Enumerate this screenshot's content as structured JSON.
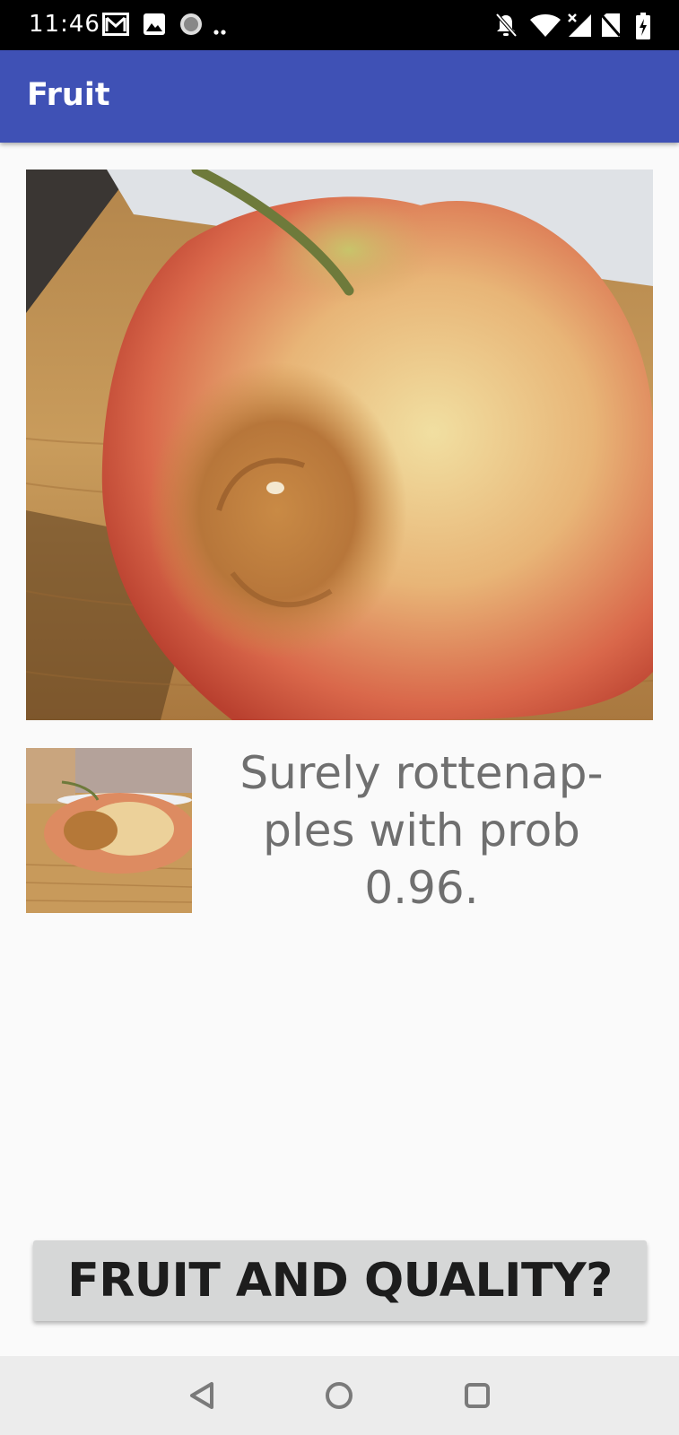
{
  "status_bar": {
    "time": "11:46",
    "left_icons": [
      "gmail-icon",
      "gallery-icon",
      "circle-notification-icon",
      "more-notifications-icon"
    ],
    "right_icons": [
      "mute-icon",
      "wifi-icon",
      "no-signal-icon",
      "no-sim-icon",
      "battery-charging-icon"
    ]
  },
  "app_bar": {
    "title": "Fruit"
  },
  "main_image": {
    "description": "apple-photo"
  },
  "thumbnail": {
    "description": "apple-thumbnail"
  },
  "result": {
    "text": "Surely rottenap- ples with prob 0.96."
  },
  "action_button": {
    "label": "FRUIT AND QUALITY?"
  },
  "nav_bar": {
    "buttons": [
      "back-icon",
      "home-icon",
      "recents-icon"
    ]
  },
  "colors": {
    "app_bar": "#3f51b5",
    "background": "#fafafa",
    "button": "#d6d7d7",
    "result_text": "#6f6f6f"
  }
}
